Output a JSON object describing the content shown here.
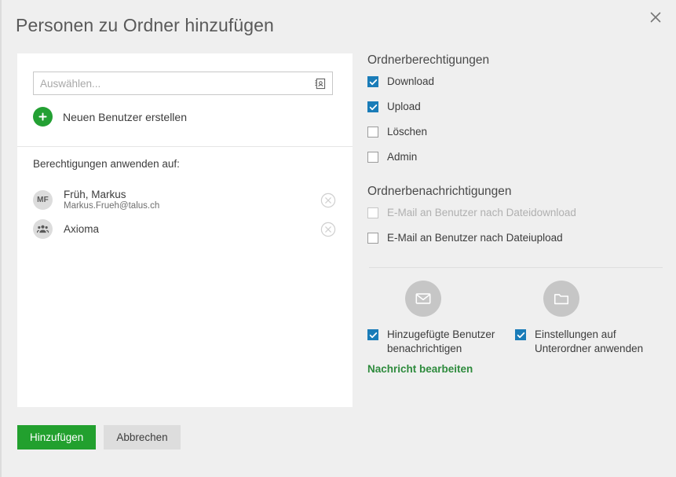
{
  "dialog": {
    "title": "Personen zu Ordner hinzufügen",
    "close_icon": "close-icon"
  },
  "picker": {
    "input_value": "",
    "placeholder": "Auswählen...",
    "addressbook_icon": "address-book-icon",
    "create_user_label": "Neuen Benutzer erstellen",
    "plus_icon": "plus-icon"
  },
  "apply_to": {
    "label": "Berechtigungen anwenden auf:",
    "people": [
      {
        "initials": "MF",
        "name": "Früh, Markus",
        "email": "Markus.Frueh@talus.ch",
        "type": "user",
        "remove_icon": "remove-circle-icon"
      },
      {
        "initials": "",
        "name": "Axioma",
        "email": "",
        "type": "group",
        "remove_icon": "remove-circle-icon"
      }
    ]
  },
  "permissions": {
    "title": "Ordnerberechtigungen",
    "items": [
      {
        "label": "Download",
        "checked": true,
        "disabled": false
      },
      {
        "label": "Upload",
        "checked": true,
        "disabled": false
      },
      {
        "label": "Löschen",
        "checked": false,
        "disabled": false
      },
      {
        "label": "Admin",
        "checked": false,
        "disabled": false
      }
    ]
  },
  "notifications": {
    "title": "Ordnerbenachrichtigungen",
    "items": [
      {
        "label": "E-Mail an Benutzer nach Dateidownload",
        "checked": false,
        "disabled": true
      },
      {
        "label": "E-Mail an Benutzer nach Dateiupload",
        "checked": false,
        "disabled": false
      }
    ]
  },
  "options": {
    "notify": {
      "icon": "mail-icon",
      "label": "Hinzugefügte Benutzer benachrichtigen",
      "checked": true,
      "edit_message_link": "Nachricht bearbeiten"
    },
    "subfolders": {
      "icon": "folder-icon",
      "label": "Einstellungen auf Unterordner anwenden",
      "checked": true
    }
  },
  "footer": {
    "submit_label": "Hinzufügen",
    "cancel_label": "Abbrechen"
  },
  "colors": {
    "accent_green": "#22a02e",
    "checkbox_blue": "#1a7cb8",
    "link_green": "#2e8b3d",
    "page_bg": "#efefef"
  }
}
